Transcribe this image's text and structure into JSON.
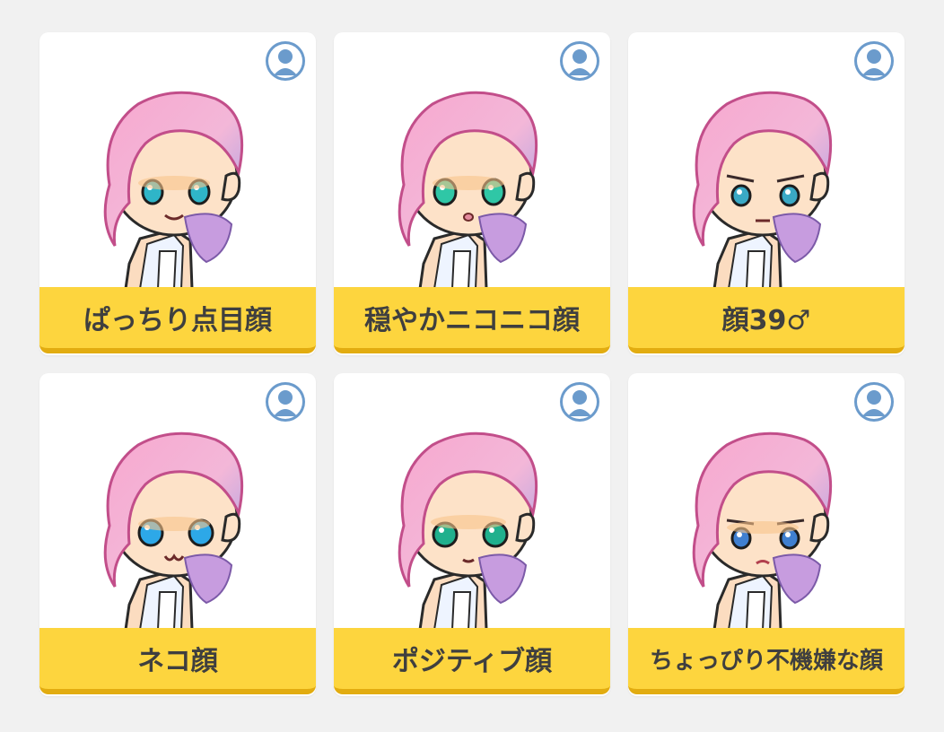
{
  "colors": {
    "page_background": "#f1f1f1",
    "card_background": "#ffffff",
    "label_background": "#fdd53e",
    "label_border": "#e2ac10",
    "label_text": "#3f3f3f",
    "badge_fill": "#6b9bcc",
    "hair_pink": "#f29cc8",
    "hair_lilac": "#a9a8ea"
  },
  "cards": [
    {
      "label": "ぱっちり点目顔",
      "eye_color": "#2fb5c8",
      "mouth": "smile",
      "icon": "user-silhouette-icon"
    },
    {
      "label": "穏やかニコニコ顔",
      "eye_color": "#2fc7a6",
      "mouth": "small-o",
      "icon": "user-silhouette-icon"
    },
    {
      "label": "顔39♂",
      "eye_color": "#3aa9c5",
      "mouth": "flat",
      "icon": "user-silhouette-icon"
    },
    {
      "label": "ネコ顔",
      "eye_color": "#2da8e8",
      "mouth": "cat",
      "icon": "user-silhouette-icon"
    },
    {
      "label": "ポジティブ顔",
      "eye_color": "#20b08d",
      "mouth": "small",
      "icon": "user-silhouette-icon"
    },
    {
      "label": "ちょっぴり不機嫌な顔",
      "eye_color": "#3f7fd0",
      "mouth": "pout",
      "icon": "user-silhouette-icon"
    }
  ]
}
